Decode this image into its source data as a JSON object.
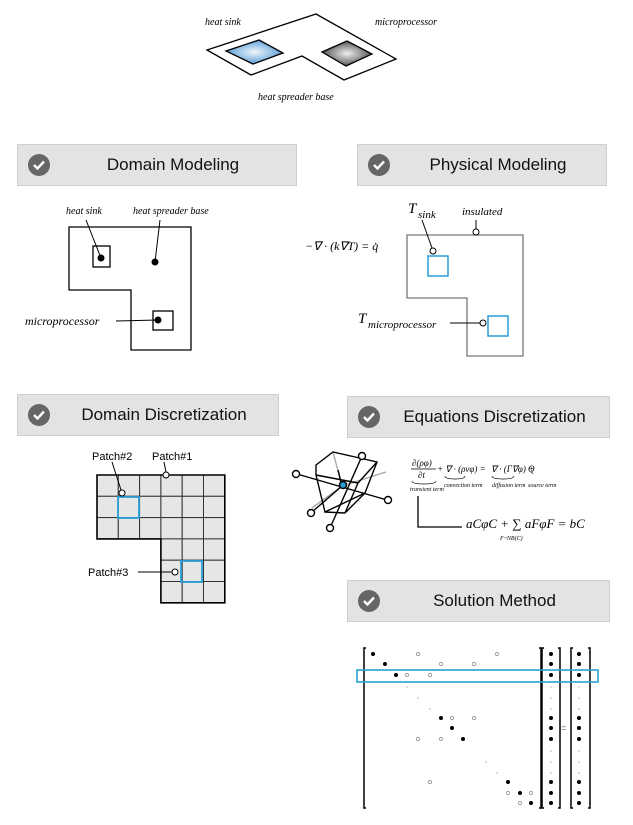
{
  "top": {
    "heat_sink": "heat sink",
    "microprocessor": "microprocessor",
    "base": "heat spreader base"
  },
  "sections": {
    "domain_modeling": {
      "title": "Domain Modeling",
      "heat_sink": "heat sink",
      "base": "heat spreader base",
      "microprocessor": "microprocessor"
    },
    "physical_modeling": {
      "title": "Physical Modeling",
      "equation": "−∇ · (k∇T) = q̇",
      "t_sink": "T",
      "t_sink_sub": "sink",
      "insulated": "insulated",
      "t_micro": "T",
      "t_micro_sub": "microprocessor"
    },
    "domain_discretization": {
      "title": "Domain Discretization",
      "patch1": "Patch#1",
      "patch2": "Patch#2",
      "patch3": "Patch#3"
    },
    "equations_discretization": {
      "title": "Equations Discretization",
      "transient_num": "∂(ρφ)",
      "transient_den": "∂t",
      "convection": "+ ∇ · (ρvφ) =",
      "diffusion": "∇ · (Γ∇φ) +",
      "source": "Q",
      "transient_label": "transient term",
      "convection_label": "convection term",
      "diffusion_label": "diffusion term",
      "source_label": "source term",
      "discrete": "aCφC + ∑ aFφF = bC",
      "sum_sub": "F~NB(C)"
    },
    "solution_method": {
      "title": "Solution Method",
      "equals": "="
    }
  },
  "colors": {
    "accent": "#2a9fd6",
    "header_bg": "#e3e3e3",
    "check": "#666666"
  }
}
